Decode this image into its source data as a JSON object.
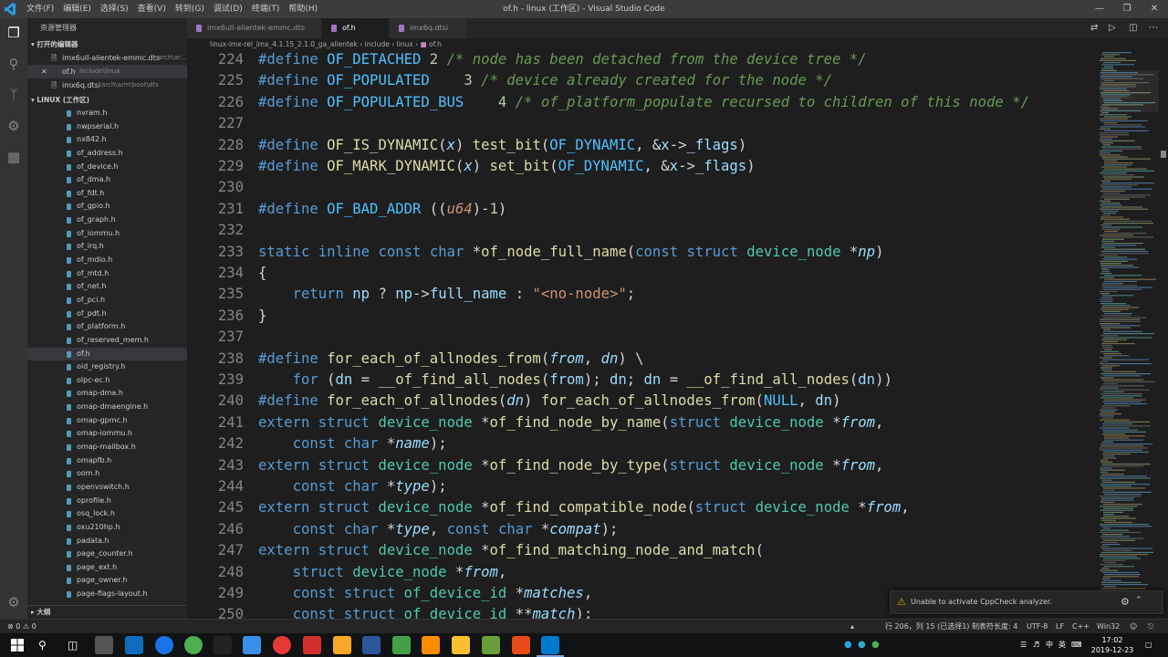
{
  "window": {
    "title": "of.h - linux (工作区) - Visual Studio Code",
    "menu": [
      "文件(F)",
      "编辑(E)",
      "选择(S)",
      "查看(V)",
      "转到(G)",
      "调试(D)",
      "终端(T)",
      "帮助(H)"
    ]
  },
  "sidebar": {
    "title": "资源管理器",
    "open_editors_header": "打开的编辑器",
    "open_editors": [
      {
        "name": "imx6ull-alientek-emmc.dts",
        "path": "arch\\ar..."
      },
      {
        "name": "of.h",
        "path": "include\\linux"
      },
      {
        "name": "imx6q.dtsi",
        "path": "arch\\arm\\boot\\dts"
      }
    ],
    "workspace_header": "LINUX (工作区)",
    "files": [
      "nvram.h",
      "nwpserial.h",
      "nx842.h",
      "of_address.h",
      "of_device.h",
      "of_dma.h",
      "of_fdt.h",
      "of_gpio.h",
      "of_graph.h",
      "of_iommu.h",
      "of_irq.h",
      "of_mdio.h",
      "of_mtd.h",
      "of_net.h",
      "of_pci.h",
      "of_pdt.h",
      "of_platform.h",
      "of_reserved_mem.h",
      "of.h",
      "oid_registry.h",
      "olpc-ec.h",
      "omap-dma.h",
      "omap-dmaengine.h",
      "omap-gpmc.h",
      "omap-iommu.h",
      "omap-mailbox.h",
      "omapfb.h",
      "oom.h",
      "openvswitch.h",
      "oprofile.h",
      "osq_lock.h",
      "oxu210hp.h",
      "padata.h",
      "page_counter.h",
      "page_ext.h",
      "page_owner.h",
      "page-flags-layout.h"
    ],
    "selected_file": "of.h",
    "outline_header": "大纲"
  },
  "tabs": [
    {
      "label": "imx6ull-alientek-emmc.dts",
      "color": "#a074c4"
    },
    {
      "label": "of.h",
      "color": "#a074c4"
    },
    {
      "label": "imx6q.dtsi",
      "color": "#a074c4"
    }
  ],
  "active_tab": "of.h",
  "breadcrumb": [
    "linux-imx-rel_imx_4.1.15_2.1.0_ga_alientek",
    "include",
    "linux",
    "of.h"
  ],
  "editor": {
    "line_numbers": [
      "224",
      "225",
      "226",
      "227",
      "228",
      "229",
      "230",
      "231",
      "232",
      "233",
      "234",
      "235",
      "236",
      "237",
      "238",
      "239",
      "240",
      "241",
      "242",
      "243",
      "244",
      "245",
      "246",
      "247",
      "248",
      "249",
      "250"
    ]
  },
  "notification": {
    "text": "Unable to activate CppCheck analyzer."
  },
  "status": {
    "errors": "0",
    "warnings": "0",
    "position": "行 206，列 15 (已选择1)",
    "indent": "制表符长度: 4",
    "encoding": "UTF-8",
    "eol": "LF",
    "language": "C++",
    "platform": "Win32"
  },
  "taskbar": {
    "time": "17:02",
    "date": "2019-12-23",
    "ime": "英",
    "lang": "中"
  },
  "colors": {
    "accent": "#007acc",
    "keyword": "#569cd6",
    "macro": "#4fc1ff",
    "number": "#b5cea8",
    "comment": "#6a9955",
    "function": "#dcdcaa",
    "type": "#4ec9b0",
    "param": "#9cdcfe",
    "string": "#ce9178"
  }
}
